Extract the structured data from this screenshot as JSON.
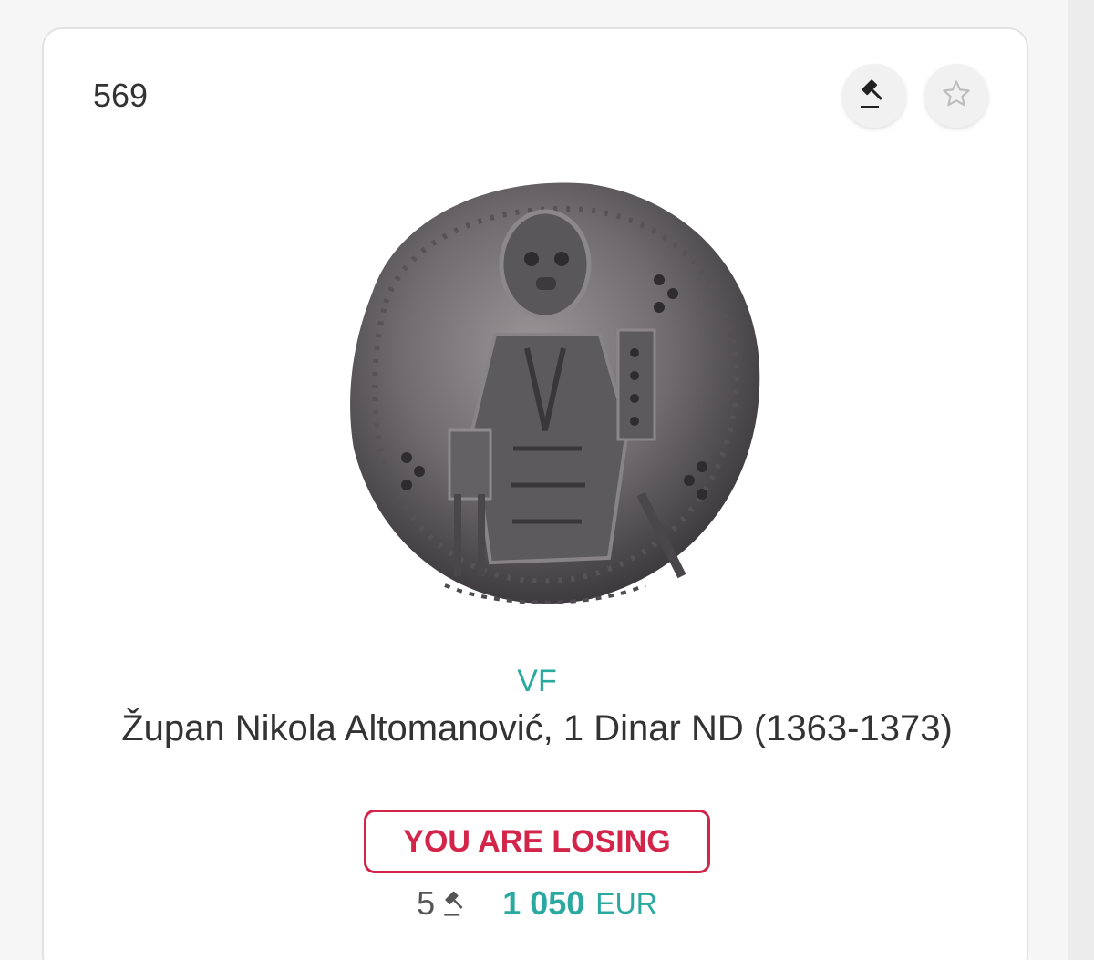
{
  "lot": {
    "number": "569",
    "grade": "VF",
    "title": "Župan Nikola Altomanović, 1 Dinar ND (1363-1373)",
    "status": "YOU ARE LOSING",
    "bid_count": "5",
    "price": "1 050",
    "currency": "EUR"
  },
  "icons": {
    "bid": "gavel-icon",
    "favorite": "star-outline-icon",
    "bid_count": "gavel-icon"
  },
  "colors": {
    "accent": "#29a9a0",
    "losing": "#d3244a",
    "text": "#333333"
  }
}
